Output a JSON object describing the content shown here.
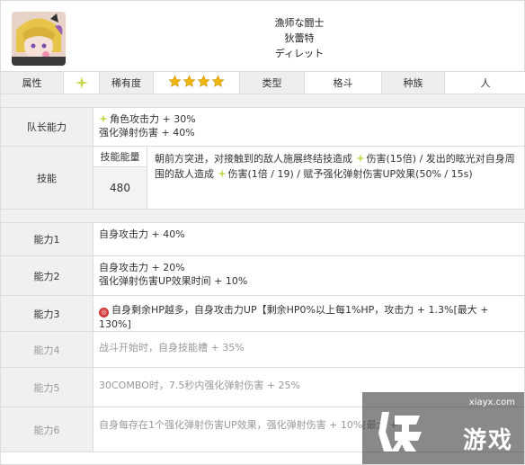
{
  "header": {
    "title_line1": "漁师な闘士",
    "title_line2": "狄蕾特",
    "title_line3": "ディレット"
  },
  "attributes": {
    "attribute_label": "属性",
    "rarity_label": "稀有度",
    "rarity_stars": 4,
    "type_label": "类型",
    "type_value": "格斗",
    "race_label": "种族",
    "race_value": "人"
  },
  "leader": {
    "label": "队长能力",
    "line1": "角色攻击力 + 30%",
    "line2": "强化弹射伤害 + 40%"
  },
  "skill": {
    "label": "技能",
    "energy_label": "技能能量",
    "energy_value": "480",
    "text_part1": "朝前方突进，对接触到的敌人施展终结技造成",
    "text_part2": "伤害(15倍) / 发出的眩光对自身周围的敌人造成",
    "text_part3": "伤害(1倍 / 19) / 赋予强化弹射伤害UP效果(50% / 15s)"
  },
  "abilities": [
    {
      "label": "能力1",
      "lines": [
        "自身攻击力 + 40%"
      ]
    },
    {
      "label": "能力2",
      "lines": [
        "自身攻击力 + 20%",
        "强化弹射伤害UP效果时间 + 10%"
      ]
    },
    {
      "label": "能力3",
      "lines": [
        "自身剩余HP越多，自身攻击力UP【剩余HP0%以上每1%HP，攻击力 + 1.3%[最大 + 130%]"
      ]
    },
    {
      "label": "能力4",
      "lines": [
        "战斗开始时，自身技能槽 + 35%"
      ]
    },
    {
      "label": "能力5",
      "lines": [
        "30COMBO时，7.5秒内强化弹射伤害 + 25%"
      ]
    },
    {
      "label": "能力6",
      "lines": [
        "自身每存在1个强化弹射伤害UP效果，强化弹射伤害 + 10%[最大 +"
      ]
    }
  ],
  "watermark": {
    "url": "xiayx.com",
    "text": "游戏"
  },
  "colors": {
    "header_bg": "#eeeeee",
    "border": "#dcdcdc",
    "star": "#f2b90f",
    "badge_red": "#d23b3b",
    "sparkle": "#c8d84a"
  },
  "icons": [
    "sparkle-icon",
    "star-icon",
    "character-avatar",
    "hp-badge-icon"
  ]
}
